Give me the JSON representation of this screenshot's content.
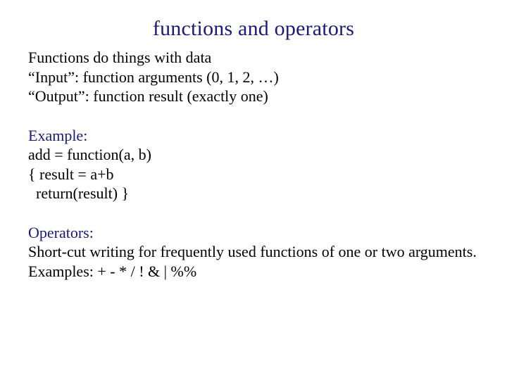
{
  "title": "functions and operators",
  "intro": {
    "line1": "Functions do things with data",
    "line2": "“Input”: function arguments (0, 1, 2, …)",
    "line3": "“Output”: function result (exactly one)"
  },
  "example": {
    "heading": "Example:",
    "line1": "add = function(a, b)",
    "line2": "{ result = a+b",
    "line3": "  return(result) }"
  },
  "operators": {
    "heading": "Operators:",
    "line1": "Short-cut writing for frequently used functions of one or two arguments.",
    "line2": "Examples: + - * / ! & | %%"
  }
}
